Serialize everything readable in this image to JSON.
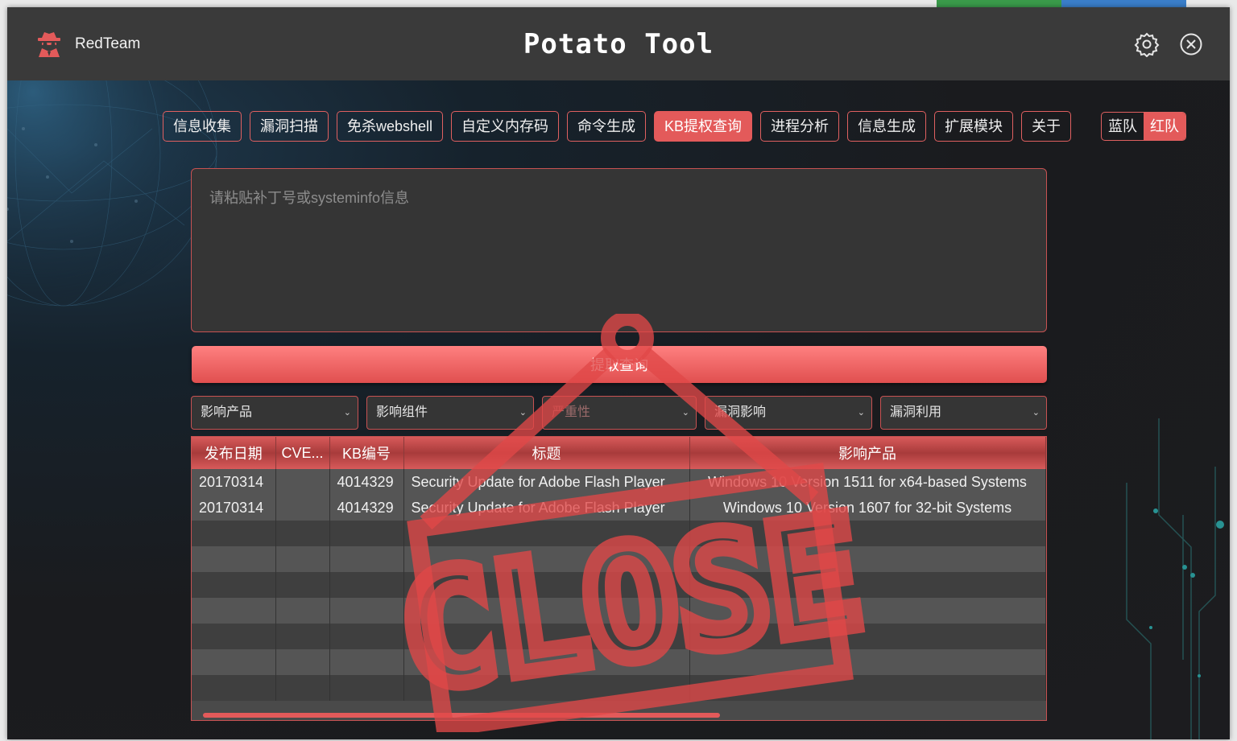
{
  "window": {
    "brand_name": "RedTeam",
    "app_title": "Potato Tool"
  },
  "tabs": [
    {
      "label": "信息收集",
      "active": false
    },
    {
      "label": "漏洞扫描",
      "active": false
    },
    {
      "label": "免杀webshell",
      "active": false
    },
    {
      "label": "自定义内存码",
      "active": false
    },
    {
      "label": "命令生成",
      "active": false
    },
    {
      "label": "KB提权查询",
      "active": true
    },
    {
      "label": "进程分析",
      "active": false
    },
    {
      "label": "信息生成",
      "active": false
    },
    {
      "label": "扩展模块",
      "active": false
    },
    {
      "label": "关于",
      "active": false
    }
  ],
  "team_switch": {
    "blue": "蓝队",
    "red": "红队",
    "selected": "红队"
  },
  "input": {
    "placeholder": "请粘贴补丁号或systeminfo信息",
    "value": ""
  },
  "query_button": "提取查询",
  "filters": [
    {
      "label": "影响产品"
    },
    {
      "label": "影响组件"
    },
    {
      "label": "严重性"
    },
    {
      "label": "漏洞影响"
    },
    {
      "label": "漏洞利用"
    }
  ],
  "table": {
    "headers": [
      "发布日期",
      "CVE...",
      "KB编号",
      "标题",
      "影响产品"
    ],
    "rows": [
      [
        "20170314",
        "",
        "4014329",
        "Security Update for Adobe Flash Player",
        "Windows 10 Version 1511 for x64-based Systems"
      ],
      [
        "20170314",
        "",
        "4014329",
        "Security Update for Adobe Flash Player",
        "Windows 10 Version 1607 for 32-bit Systems"
      ]
    ]
  },
  "stamp_text": "CLOSE",
  "colors": {
    "accent": "#e35a5a",
    "titlebar": "#3a3a3a",
    "panel": "#353535"
  }
}
